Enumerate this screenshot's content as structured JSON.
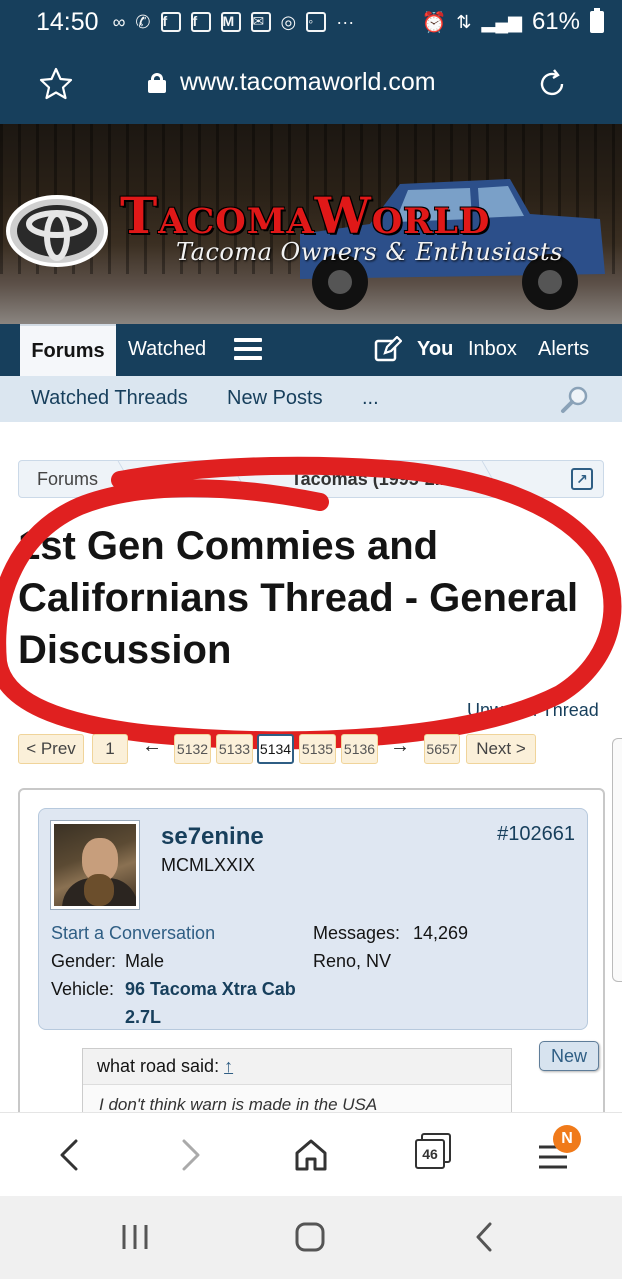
{
  "status_bar": {
    "time": "14:50",
    "battery": "61%"
  },
  "url_bar": {
    "url": "www.tacomaworld.com"
  },
  "banner": {
    "title": "TacomaWorld",
    "tagline": "Tacoma Owners & Enthusiasts"
  },
  "nav": {
    "tabs": [
      {
        "label": "Forums"
      },
      {
        "label": "Watched"
      },
      {
        "label": "You"
      },
      {
        "label": "Inbox"
      },
      {
        "label": "Alerts"
      }
    ]
  },
  "subnav": {
    "items": [
      {
        "label": "Watched Threads"
      },
      {
        "label": "New Posts"
      },
      {
        "label": "..."
      }
    ]
  },
  "breadcrumb": {
    "items": [
      {
        "label": "Forums"
      },
      {
        "label": "Tacomas (1995-2..."
      }
    ]
  },
  "thread": {
    "title": "1st Gen Commies and Californians Thread - General Discussion",
    "unwatch": "Unwatch Thread"
  },
  "pagination": {
    "prev": "< Prev",
    "first": "1",
    "left_arrow": "←",
    "pages": [
      "5132",
      "5133",
      "5134",
      "5135",
      "5136"
    ],
    "current": "5134",
    "right_arrow": "→",
    "last": "5657",
    "next": "Next >"
  },
  "post": {
    "username": "se7enine",
    "user_title": "MCMLXXIX",
    "post_number": "#102661",
    "start_conversation": "Start a Conversation",
    "gender_label": "Gender:",
    "gender": "Male",
    "vehicle_label": "Vehicle:",
    "vehicle_line1": "96 Tacoma Xtra Cab",
    "vehicle_line2": "2.7L",
    "messages_label": "Messages:",
    "messages": "14,269",
    "location": "Reno, NV",
    "new_badge": "New",
    "quote_author": "what road said:",
    "quote_up": "↑",
    "quote_text": "I don't think warn is made in the USA"
  },
  "browser_bar": {
    "tab_count": "46",
    "menu_badge": "N"
  },
  "colors": {
    "header_navy": "#173f5c",
    "subnav_blue": "#dbe6f0",
    "link_blue": "#2f5e84",
    "banner_red": "#e01818",
    "annotation_red": "#e02020",
    "badge_orange": "#f07a1a"
  }
}
